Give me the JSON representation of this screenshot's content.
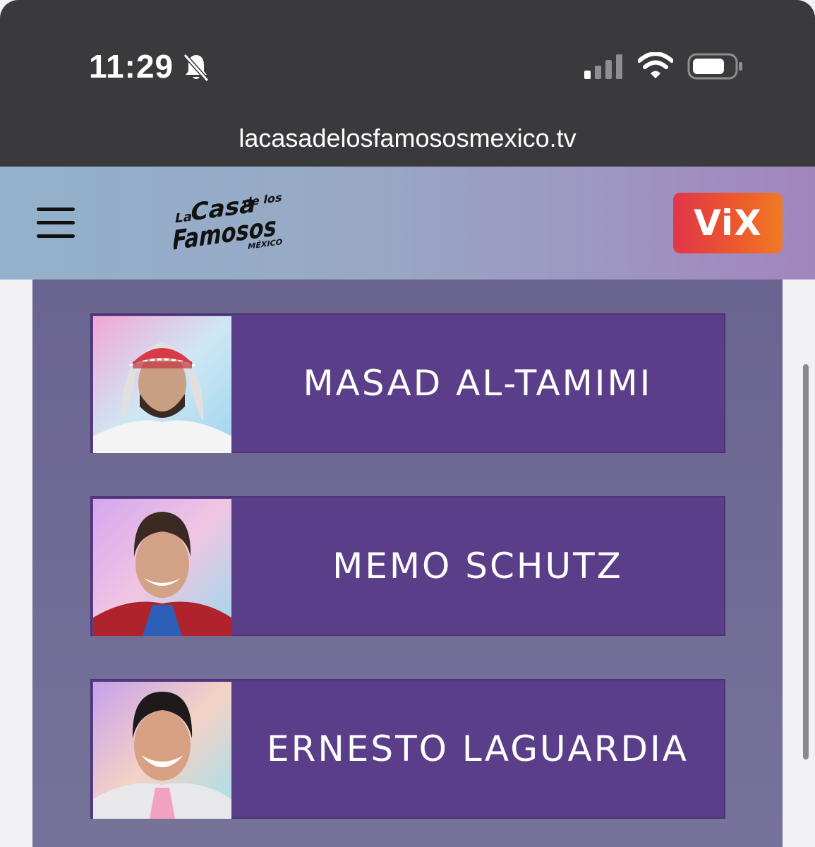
{
  "status_bar": {
    "time": "11:29"
  },
  "browser": {
    "url": "lacasadelosfamososmexico.tv"
  },
  "header": {
    "logo_lines": [
      "La",
      "Casa",
      "de los",
      "Famosos",
      "MÉXICO"
    ],
    "vix_label": "ViX"
  },
  "contestants": [
    {
      "name": "MASAD AL-TAMIMI"
    },
    {
      "name": "MEMO SCHUTZ"
    },
    {
      "name": "ERNESTO LAGUARDIA"
    }
  ],
  "icons": [
    "silent-bell-icon",
    "cell-signal-icon",
    "wifi-icon",
    "battery-icon",
    "hamburger-menu-icon"
  ]
}
